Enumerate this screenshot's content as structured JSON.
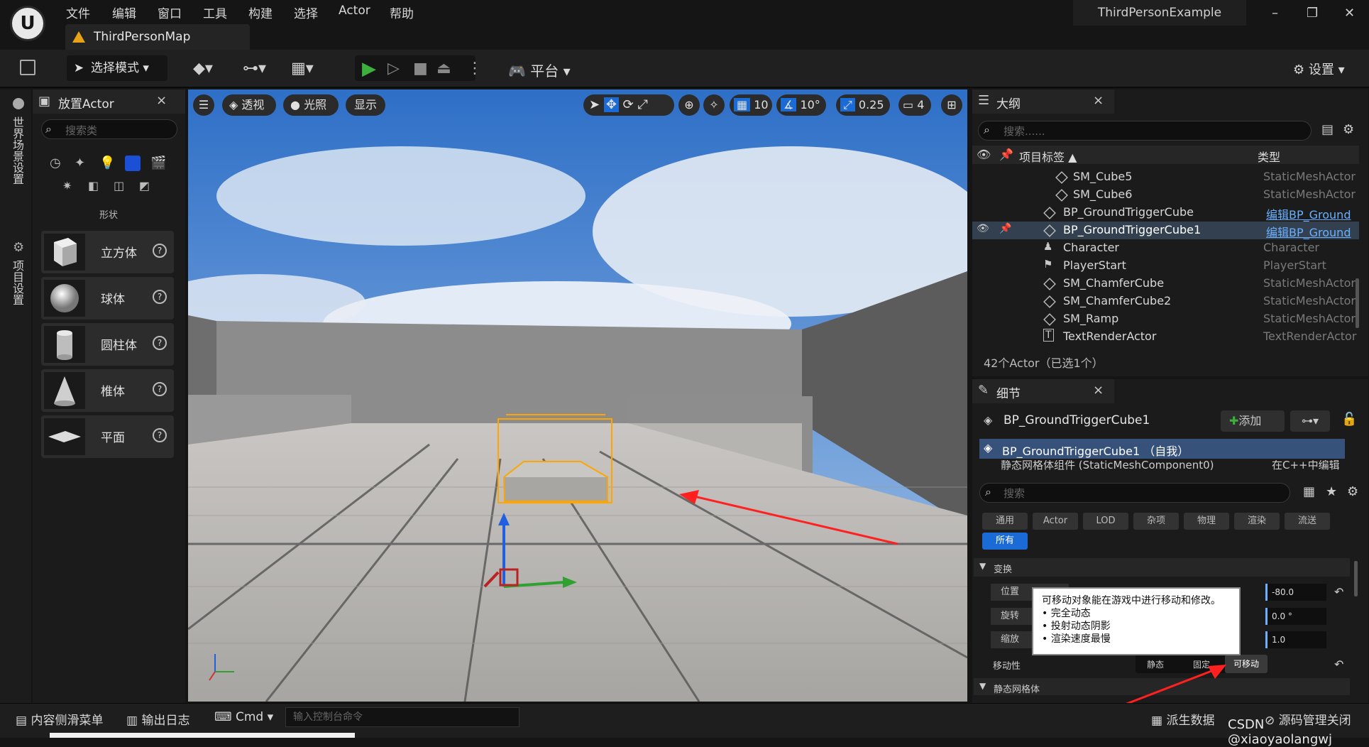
{
  "menu": [
    "文件",
    "编辑",
    "窗口",
    "工具",
    "构建",
    "选择",
    "Actor",
    "帮助"
  ],
  "map_tab": "ThirdPersonMap",
  "project_name": "ThirdPersonExample",
  "window_controls": [
    "–",
    "❐",
    "✕"
  ],
  "toolbar": {
    "select_mode": "选择模式",
    "platform": "平台",
    "settings": "设置"
  },
  "left_strip": {
    "world_settings": "世界场景设置",
    "project_settings": "项目设置"
  },
  "place_actor": {
    "title": "放置Actor",
    "close": "×",
    "search_placeholder": "搜索类",
    "section": "形状",
    "shapes": [
      {
        "label": "立方体"
      },
      {
        "label": "球体"
      },
      {
        "label": "圆柱体"
      },
      {
        "label": "椎体"
      },
      {
        "label": "平面"
      }
    ]
  },
  "viewport": {
    "perspective": "透视",
    "lighting": "光照",
    "show": "显示",
    "grid": "10",
    "angle": "10°",
    "scale": "0.25",
    "camera": "4"
  },
  "outliner": {
    "title": "大纲",
    "close": "×",
    "search_placeholder": "搜索......",
    "col_label": "项目标签 ▲",
    "col_type": "类型",
    "rows": [
      {
        "name": "SM_Cube5",
        "type": "StaticMeshActor"
      },
      {
        "name": "SM_Cube6",
        "type": "StaticMeshActor"
      },
      {
        "name": "BP_GroundTriggerCube",
        "type": "编辑BP_Ground"
      },
      {
        "name": "BP_GroundTriggerCube1",
        "type": "编辑BP_Ground"
      },
      {
        "name": "Character",
        "type": "Character"
      },
      {
        "name": "PlayerStart",
        "type": "PlayerStart"
      },
      {
        "name": "SM_ChamferCube",
        "type": "StaticMeshActor"
      },
      {
        "name": "SM_ChamferCube2",
        "type": "StaticMeshActor"
      },
      {
        "name": "SM_Ramp",
        "type": "StaticMeshActor"
      },
      {
        "name": "TextRenderActor",
        "type": "TextRenderActor"
      }
    ],
    "count": "42个Actor（已选1个）"
  },
  "details": {
    "title": "细节",
    "close": "×",
    "actor_name": "BP_GroundTriggerCube1",
    "add": "添加",
    "self_row": "BP_GroundTriggerCube1 （自我）",
    "component_row": "静态网格体组件 (StaticMeshComponent0)",
    "edit_cpp": "在C++中编辑",
    "search_placeholder": "搜索",
    "categories": [
      "通用",
      "Actor",
      "LOD",
      "杂项",
      "物理",
      "渲染",
      "流送"
    ],
    "all": "所有",
    "transform": "变换",
    "location": "位置",
    "rotation": "旋转",
    "scale": "缩放",
    "loc_z": "-80.0",
    "rot_z": "0.0 °",
    "scale_z": "1.0",
    "mobility": "移动性",
    "mob_static": "静态",
    "mob_stationary": "固定",
    "mob_movable": "可移动",
    "static_mesh": "静态网格体"
  },
  "tooltip": {
    "line1": "可移动对象能在游戏中进行移动和修改。",
    "line2": "• 完全动态",
    "line3": "• 投射动态阴影",
    "line4": "• 渲染速度最慢"
  },
  "statusbar": {
    "content_drawer": "内容侧滑菜单",
    "output_log": "输出日志",
    "cmd": "Cmd",
    "cmd_placeholder": "输入控制台命令",
    "derived_data": "派生数据",
    "source_control": "源码管理关闭"
  },
  "watermark": "CSDN @xiaoyaolangwj",
  "colors": {
    "accent": "#1a6bd6",
    "play": "#3cb03c",
    "selection": "#ffa500",
    "arrow": "#ff2020"
  }
}
